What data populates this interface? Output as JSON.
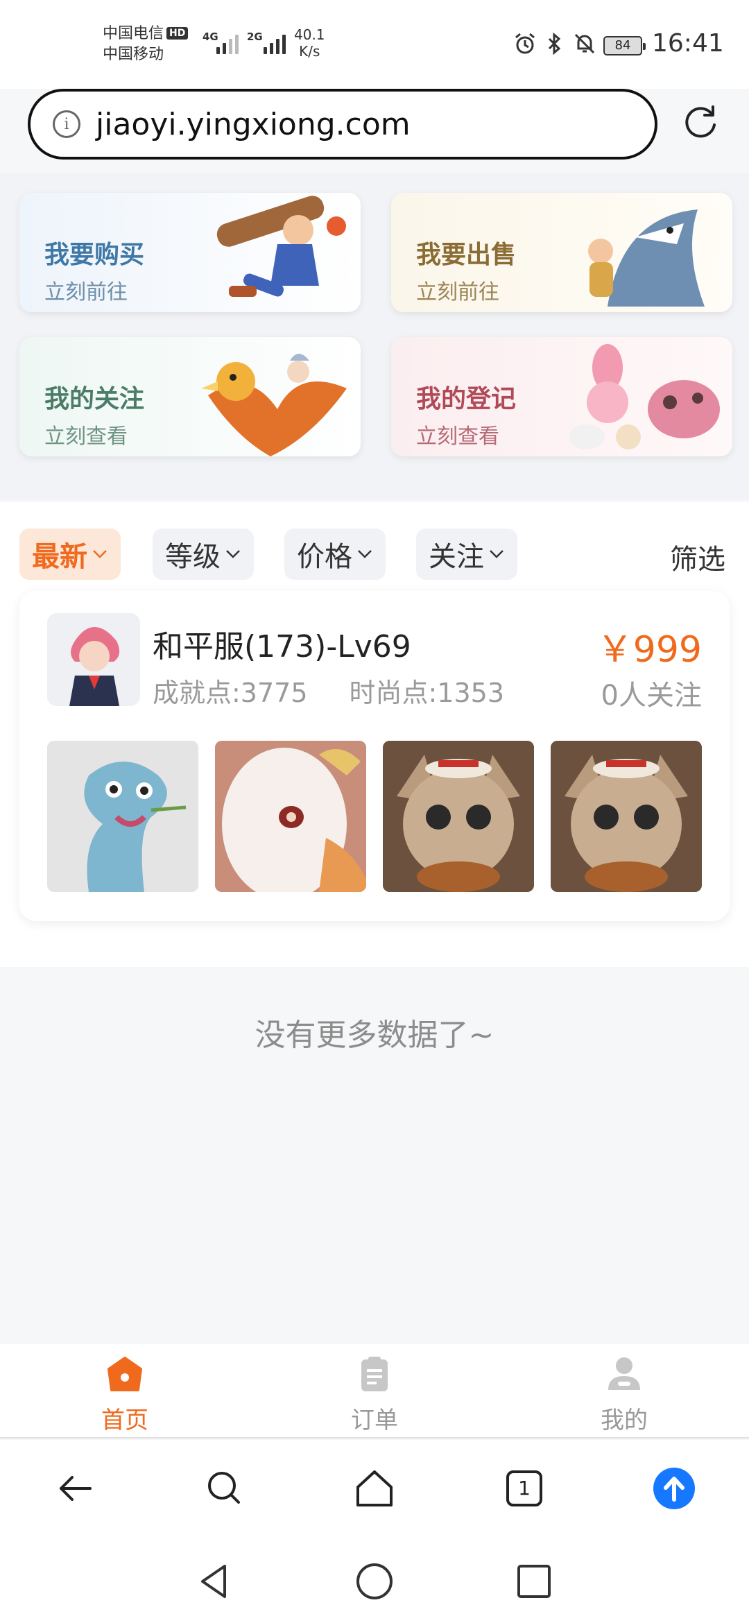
{
  "status_bar": {
    "carrier_1": "中国电信",
    "hd_badge": "HD",
    "carrier_2": "中国移动",
    "net_1": "4G",
    "net_2": "2G",
    "speed_value": "40.1",
    "speed_unit": "K/s",
    "battery": "84",
    "time": "16:41"
  },
  "browser": {
    "url": "jiaoyi.yingxiong.com"
  },
  "quick_cards": [
    {
      "title": "我要购买",
      "subtitle": "立刻前往"
    },
    {
      "title": "我要出售",
      "subtitle": "立刻前往"
    },
    {
      "title": "我的关注",
      "subtitle": "立刻查看"
    },
    {
      "title": "我的登记",
      "subtitle": "立刻查看"
    }
  ],
  "filters": {
    "chips": [
      {
        "label": "最新",
        "active": true
      },
      {
        "label": "等级",
        "active": false
      },
      {
        "label": "价格",
        "active": false
      },
      {
        "label": "关注",
        "active": false
      }
    ],
    "filter_label": "筛选"
  },
  "listing": {
    "title": "和平服(173)-Lv69",
    "achievement": "成就点:3775",
    "fashion": "时尚点:1353",
    "price": "￥999",
    "followers": "0人关注",
    "thumbnails": [
      "dragon",
      "rabbit",
      "squirrel",
      "squirrel"
    ]
  },
  "no_more": "没有更多数据了~",
  "tabs": [
    {
      "label": "首页",
      "icon": "home-icon",
      "active": true
    },
    {
      "label": "订单",
      "icon": "clipboard-icon",
      "active": false
    },
    {
      "label": "我的",
      "icon": "user-icon",
      "active": false
    }
  ],
  "toolbar": {
    "tab_count": "1"
  },
  "colors": {
    "accent": "#f06a1e",
    "browser_blue": "#1677ff"
  }
}
